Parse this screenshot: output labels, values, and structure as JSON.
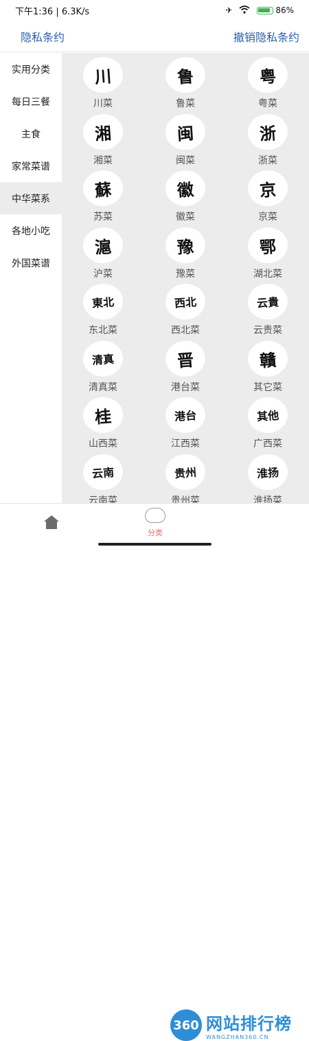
{
  "status_bar": {
    "time": "下午1:36 | 6.3K/s",
    "battery": "86%"
  },
  "header": {
    "privacy_label": "隐私条约",
    "revoke_label": "撤销隐私条约"
  },
  "sidebar": {
    "items": [
      {
        "label": "实用分类"
      },
      {
        "label": "每日三餐"
      },
      {
        "label": "主食"
      },
      {
        "label": "家常菜谱"
      },
      {
        "label": "中华菜系"
      },
      {
        "label": "各地小吃"
      },
      {
        "label": "外国菜谱"
      }
    ]
  },
  "cuisines": [
    {
      "glyph": "川",
      "label": "川菜"
    },
    {
      "glyph": "鲁",
      "label": "鲁菜"
    },
    {
      "glyph": "粤",
      "label": "粤菜"
    },
    {
      "glyph": "湘",
      "label": "湘菜"
    },
    {
      "glyph": "闽",
      "label": "闽菜"
    },
    {
      "glyph": "浙",
      "label": "浙菜"
    },
    {
      "glyph": "蘇",
      "label": "苏菜"
    },
    {
      "glyph": "徽",
      "label": "徽菜"
    },
    {
      "glyph": "京",
      "label": "京菜"
    },
    {
      "glyph": "滬",
      "label": "沪菜"
    },
    {
      "glyph": "豫",
      "label": "豫菜"
    },
    {
      "glyph": "鄂",
      "label": "湖北菜"
    },
    {
      "glyph": "東北",
      "label": "东北菜"
    },
    {
      "glyph": "西北",
      "label": "西北菜"
    },
    {
      "glyph": "云貴",
      "label": "云贵菜"
    },
    {
      "glyph": "清真",
      "label": "清真菜"
    },
    {
      "glyph": "晋",
      "label": "港台菜"
    },
    {
      "glyph": "贛",
      "label": "其它菜"
    },
    {
      "glyph": "桂",
      "label": "山西菜"
    },
    {
      "glyph": "港台",
      "label": "江西菜"
    },
    {
      "glyph": "其他",
      "label": "广西菜"
    },
    {
      "glyph": "云南",
      "label": "云南菜"
    },
    {
      "glyph": "贵州",
      "label": "贵州菜"
    },
    {
      "glyph": "淮扬",
      "label": "淮扬菜"
    }
  ],
  "tabbar": {
    "category_label": "分类"
  },
  "watermark": {
    "logo": "360",
    "cn": "网站排行榜",
    "en": "WANGZHAN360.CN"
  },
  "colors": {
    "link": "#2a5fa8",
    "active_bg": "#ececec",
    "tab_active": "#e66a6a",
    "watermark": "#2d8ed8"
  }
}
